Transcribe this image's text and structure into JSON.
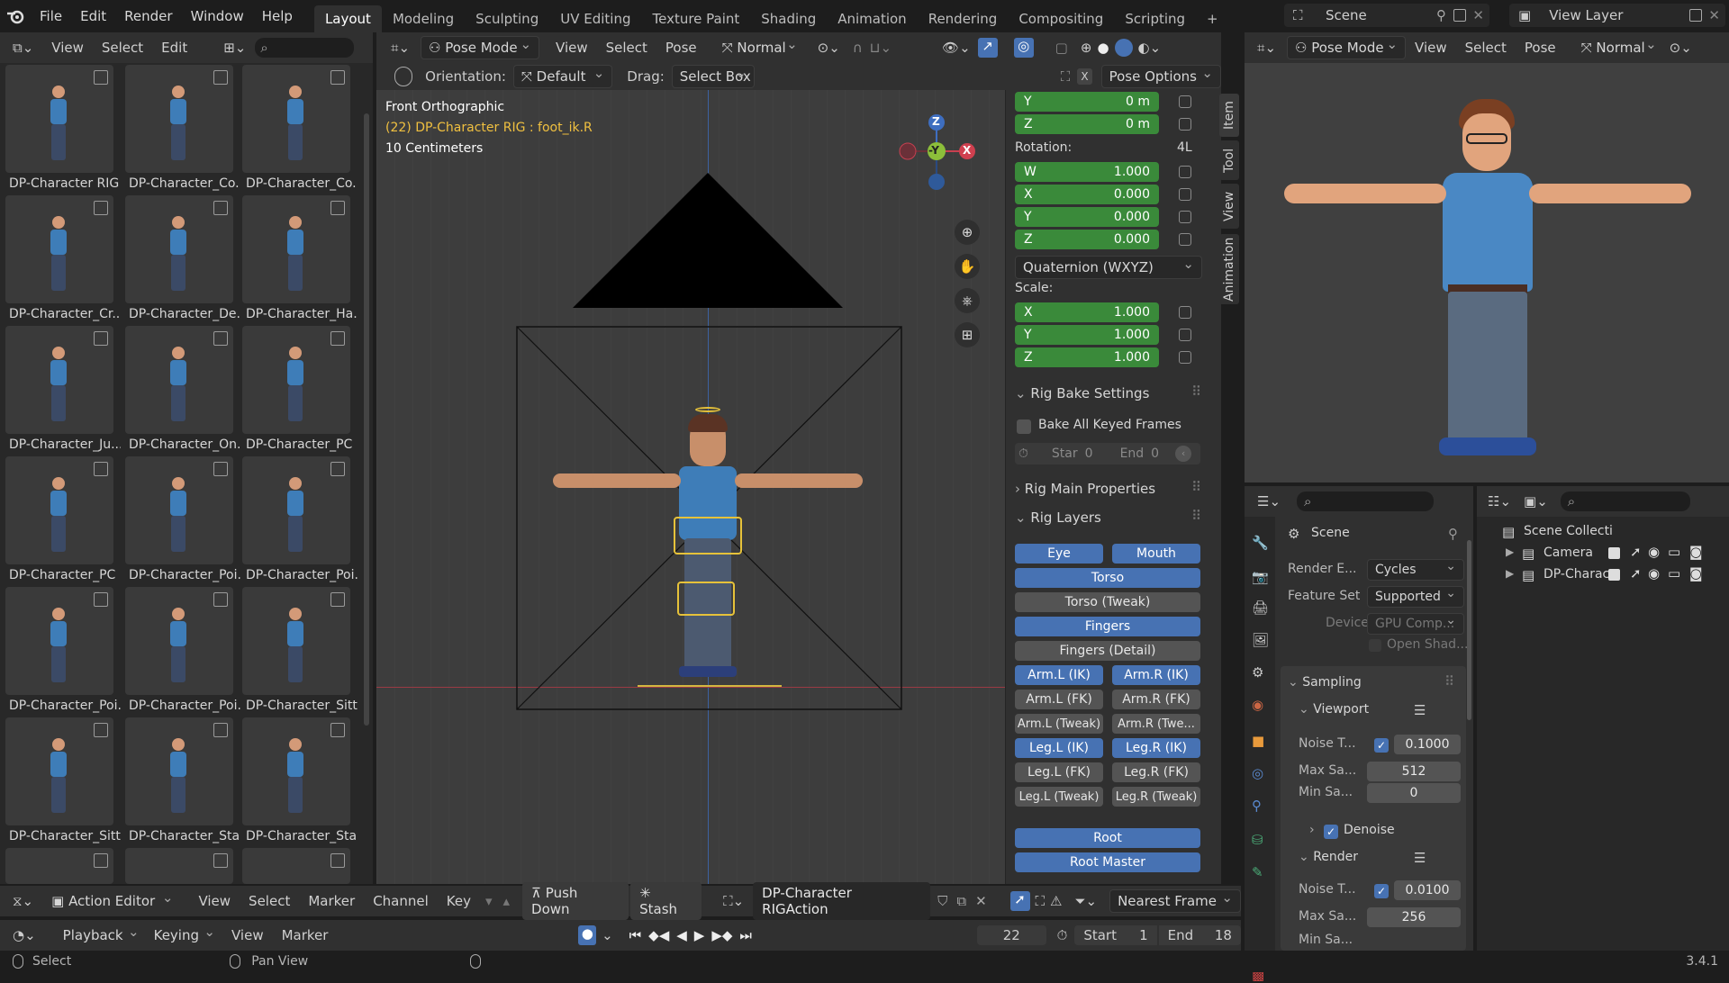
{
  "topmenu": {
    "items": [
      "File",
      "Edit",
      "Render",
      "Window",
      "Help"
    ],
    "workspaces": [
      "Layout",
      "Modeling",
      "Sculpting",
      "UV Editing",
      "Texture Paint",
      "Shading",
      "Animation",
      "Rendering",
      "Compositing",
      "Scripting"
    ],
    "add": "+",
    "scene": "Scene",
    "view_layer": "View Layer"
  },
  "asset_browser": {
    "header": [
      "View",
      "Select",
      "Edit"
    ],
    "items": [
      "DP-Character RIG",
      "DP-Character_Co...",
      "DP-Character_Co...",
      "DP-Character_Cr...",
      "DP-Character_De...",
      "DP-Character_Ha...",
      "DP-Character_Ju...",
      "DP-Character_On...",
      "DP-Character_PC ...",
      "DP-Character_PC ...",
      "DP-Character_Poi...",
      "DP-Character_Poi...",
      "DP-Character_Poi...",
      "DP-Character_Poi...",
      "DP-Character_Sitt...",
      "DP-Character_Sitt...",
      "DP-Character_Sta...",
      "DP-Character_Sta..."
    ]
  },
  "viewport": {
    "mode": "Pose Mode",
    "menus": [
      "View",
      "Select",
      "Pose"
    ],
    "transform": "Normal",
    "orientation_label": "Orientation:",
    "orientation": "Default",
    "drag_label": "Drag:",
    "drag": "Select Box",
    "pose_options": "Pose Options",
    "overlay_line1": "Front Orthographic",
    "overlay_line2": "(22) DP-Character RIG : foot_ik.R",
    "overlay_line3": "10 Centimeters",
    "gizmo": {
      "z": "Z",
      "y": "-Y",
      "x": "X"
    }
  },
  "npanel": {
    "tabs": [
      "Item",
      "Tool",
      "View",
      "Animation"
    ],
    "loc_y_label": "Y",
    "loc_y": "0 m",
    "loc_z_label": "Z",
    "loc_z": "0 m",
    "rotation_label": "Rotation:",
    "rotation_mode_tag": "4L",
    "rot": [
      {
        "l": "W",
        "v": "1.000"
      },
      {
        "l": "X",
        "v": "0.000"
      },
      {
        "l": "Y",
        "v": "0.000"
      },
      {
        "l": "Z",
        "v": "0.000"
      }
    ],
    "rot_mode": "Quaternion (WXYZ)",
    "scale_label": "Scale:",
    "scale": [
      {
        "l": "X",
        "v": "1.000"
      },
      {
        "l": "Y",
        "v": "1.000"
      },
      {
        "l": "Z",
        "v": "1.000"
      }
    ],
    "rig_bake": "Rig Bake Settings",
    "bake_all": "Bake All Keyed Frames",
    "start_label": "Star",
    "start_val": "0",
    "end_label": "End",
    "end_val": "0",
    "rig_main": "Rig Main Properties",
    "rig_layers": "Rig Layers",
    "layers": {
      "eye": "Eye",
      "mouth": "Mouth",
      "torso": "Torso",
      "torso_tweak": "Torso (Tweak)",
      "fingers": "Fingers",
      "fingers_detail": "Fingers (Detail)",
      "arm_l_ik": "Arm.L (IK)",
      "arm_r_ik": "Arm.R (IK)",
      "arm_l_fk": "Arm.L (FK)",
      "arm_r_fk": "Arm.R (FK)",
      "arm_l_tw": "Arm.L (Tweak)",
      "arm_r_tw": "Arm.R (Twe...",
      "leg_l_ik": "Leg.L (IK)",
      "leg_r_ik": "Leg.R (IK)",
      "leg_l_fk": "Leg.L (FK)",
      "leg_r_fk": "Leg.R (FK)",
      "leg_l_tw": "Leg.L (Tweak)",
      "leg_r_tw": "Leg.R (Tweak)",
      "root": "Root",
      "root_master": "Root Master"
    }
  },
  "right_view": {
    "mode": "Pose Mode",
    "menus": [
      "View",
      "Select",
      "Pose"
    ],
    "transform": "Normal"
  },
  "properties": {
    "scene": "Scene",
    "render_engine_label": "Render E...",
    "render_engine": "Cycles",
    "feature_set_label": "Feature Set",
    "feature_set": "Supported",
    "device_label": "Device",
    "device": "GPU Comp...",
    "open_shading": "Open Shad...",
    "sampling": "Sampling",
    "viewport": "Viewport",
    "noise_label": "Noise T...",
    "noise_val": "0.1000",
    "max_label": "Max Sa...",
    "max_val": "512",
    "min_label": "Min Sa...",
    "min_val": "0",
    "denoise": "Denoise",
    "render": "Render",
    "r_noise_val": "0.0100",
    "r_max_val": "256",
    "r_min_label": "Min Sa..."
  },
  "outliner": {
    "root": "Scene Collecti",
    "items": [
      "Camera",
      "DP-Charac"
    ]
  },
  "action_editor": {
    "mode": "Action Editor",
    "menus": [
      "View",
      "Select",
      "Marker",
      "Channel",
      "Key"
    ],
    "push_down": "Push Down",
    "stash": "Stash",
    "action": "DP-Character RIGAction",
    "snap": "Nearest Frame"
  },
  "timeline": {
    "menus": [
      "Playback",
      "Keying",
      "View",
      "Marker"
    ],
    "frame": "22",
    "start_label": "Start",
    "start": "1",
    "end_label": "End",
    "end": "18"
  },
  "statusbar": {
    "select": "Select",
    "pan": "Pan View",
    "version": "3.4.1"
  }
}
